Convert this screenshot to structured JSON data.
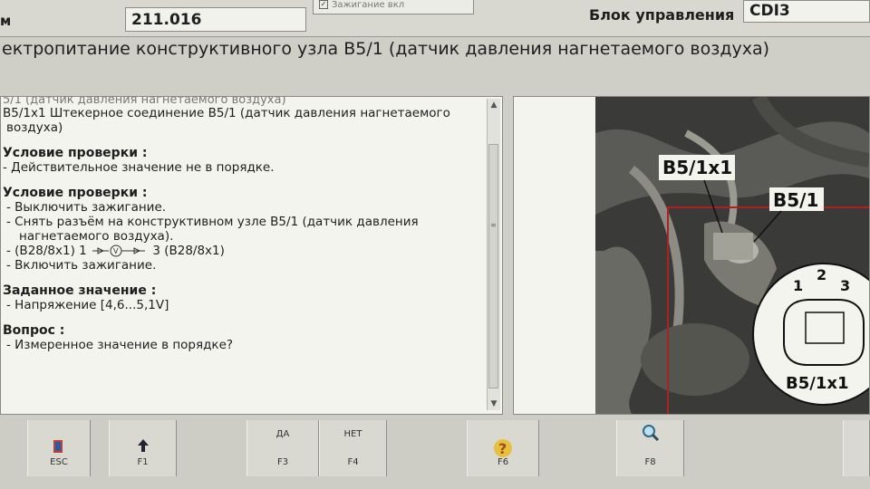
{
  "header": {
    "left_fragment": "м",
    "model_code": "211.016",
    "popup_item": "Зажигание вкл",
    "unit_label": "Блок управления",
    "unit_value": "CDI3"
  },
  "title": "ектропитание конструктивного узла B5/1 (датчик давления нагнетаемого воздуха)",
  "text_panel": {
    "cut_top_line": "5/1 (датчик давления нагнетаемого воздуха)",
    "connector_line1": "B5/1x1 Штекерное соединение B5/1 (датчик давления нагнетаемого",
    "connector_line2": "воздуха)",
    "check1_heading": "Условие проверки :",
    "check1_item": "- Действительное значение не в порядке.",
    "check2_heading": "Условие проверки :",
    "check2_step1": "- Выключить зажигание.",
    "check2_step2a": "- Снять разъём на конструктивном узле B5/1 (датчик давления",
    "check2_step2b": "нагнетаемого воздуха).",
    "measure_prefix": "- (B28/8x1) 1",
    "measure_suffix": "3 (B28/8x1)",
    "check2_step4": "- Включить зажигание.",
    "setpoint_heading": "Заданное значение :",
    "setpoint_item": "- Напряжение [4,6...5,1V]",
    "question_heading": "Вопрос :",
    "question_item": "- Измеренное значение в порядке?"
  },
  "image_panel": {
    "label_connector": "B5/1x1",
    "label_sensor": "B5/1",
    "pin1": "1",
    "pin2": "2",
    "pin3": "3",
    "detail_label": "B5/1x1"
  },
  "toolbar": {
    "esc": {
      "key": "ESC",
      "icon": "exit-door-icon"
    },
    "f1": {
      "key": "F1",
      "icon": "arrow-up-icon"
    },
    "f3": {
      "caption": "ДА",
      "key": "F3"
    },
    "f4": {
      "caption": "НЕТ",
      "key": "F4"
    },
    "f6": {
      "key": "F6",
      "icon": "help-question-icon"
    },
    "f8": {
      "key": "F8",
      "icon": "magnifier-icon"
    }
  }
}
